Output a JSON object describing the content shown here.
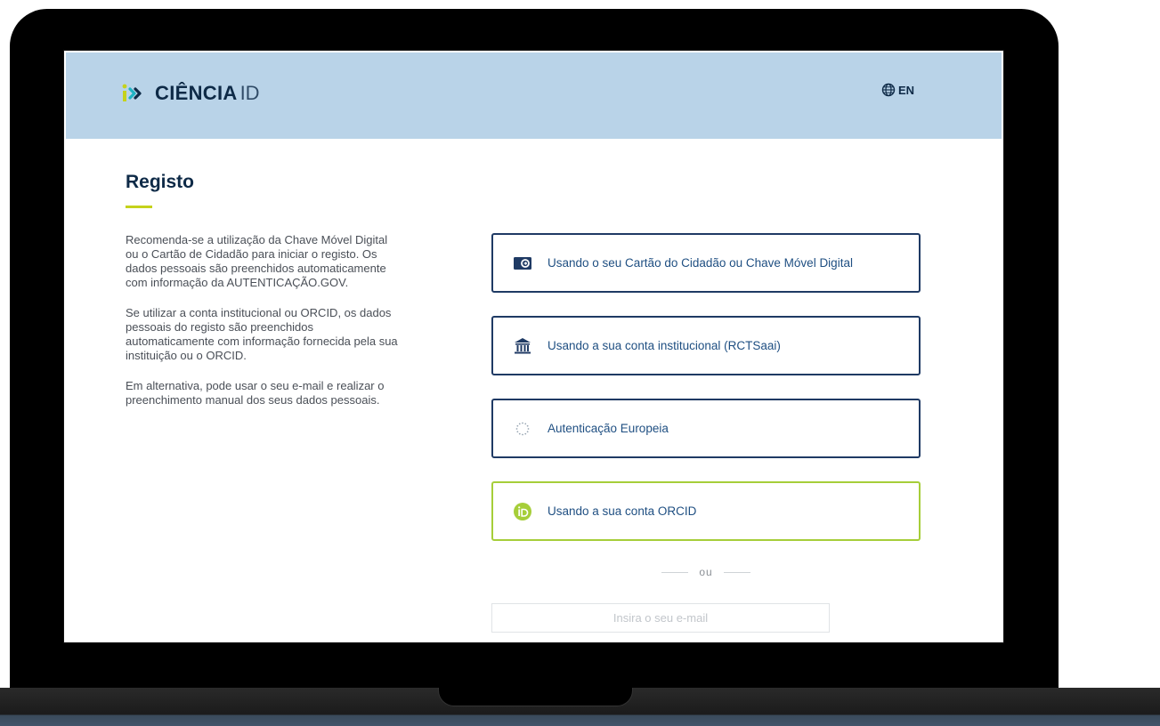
{
  "header": {
    "logo_text": "CIÊNCIA",
    "logo_suffix": "ID",
    "language_label": "EN"
  },
  "main": {
    "title": "Registo",
    "paragraphs": [
      "Recomenda-se a utilização da Chave Móvel Digital ou o Cartão de Cidadão para iniciar o registo. Os dados pessoais são preenchidos automaticamente com informação da AUTENTICAÇÃO.GOV.",
      "Se utilizar a conta institucional ou ORCID, os dados pessoais do registo são preenchidos automaticamente com informação fornecida pela sua instituição ou o ORCID.",
      "Em alternativa, pode usar o seu e-mail e realizar o preenchimento manual dos seus dados pessoais."
    ]
  },
  "options": [
    {
      "label": "Usando o seu Cartão do Cidadão ou Chave Móvel Digital",
      "icon": "citizen-card-icon"
    },
    {
      "label": "Usando a sua conta institucional (RCTSaai)",
      "icon": "institution-icon"
    },
    {
      "label": "Autenticação Europeia",
      "icon": "eu-stars-icon"
    },
    {
      "label": "Usando a sua conta ORCID",
      "icon": "orcid-icon"
    }
  ],
  "divider_text": "ou",
  "email": {
    "placeholder": "Insira o seu e-mail",
    "value": ""
  },
  "colors": {
    "header_bg": "#b9d3e8",
    "navy": "#0e2a47",
    "link_blue": "#1f4f82",
    "accent_lime": "#c5d21b",
    "orcid_green": "#a6ce39"
  }
}
